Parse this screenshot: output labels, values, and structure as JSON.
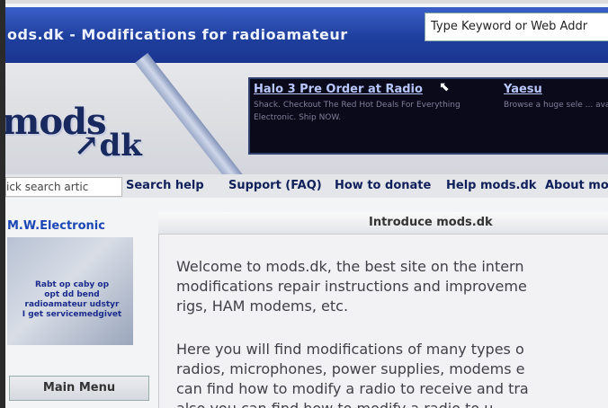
{
  "window": {
    "title": "ods.dk - Modifications for radioamateur",
    "address_placeholder": "Type Keyword or Web Addr"
  },
  "banner": {
    "logo_top": "mods",
    "logo_bottom": "dk",
    "ads": [
      {
        "title": "Halo 3 Pre Order at Radio",
        "desc": "Shack. Checkout The Red Hot Deals For Everything Electronic. Ship NOW."
      },
      {
        "title": "Yaesu",
        "desc": "Browse a huge sele ... available now ..."
      }
    ]
  },
  "nav": {
    "search_value": "ick search artic",
    "links": [
      "Search help",
      "Support (FAQ)",
      "How to donate",
      "Help mods.dk",
      "About mo"
    ]
  },
  "sidebar": {
    "sponsor_title": "M.W.Electronic",
    "sponsor_img_text": "Rabt op caby op\nopt dd bend\nradioamateur udstyr\nI get servicemedgivet",
    "main_menu": "Main Menu"
  },
  "content": {
    "header": "Introduce mods.dk",
    "para1": [
      "Welcome to mods.dk, the best site on the intern",
      "modifications repair instructions and improveme",
      "rigs, HAM modems, etc."
    ],
    "para2": [
      "Here you will find modifications of many types o",
      "radios, microphones, power supplies, modems e",
      "can find how to modify a radio to receive and tra",
      "also you can find how to modify a radio to u"
    ]
  },
  "colors": {
    "titlebar": "#1f3f9e",
    "link": "#10205a",
    "accent": "#1b47b5"
  }
}
